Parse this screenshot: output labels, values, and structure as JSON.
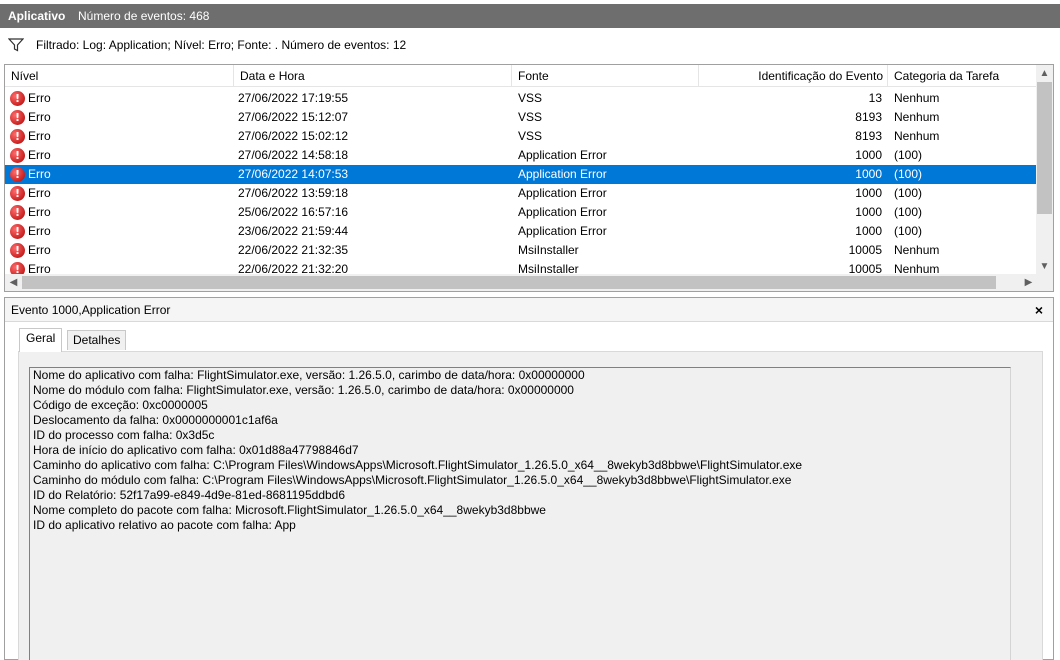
{
  "title": {
    "app": "Aplicativo",
    "count": "Número de eventos: 468"
  },
  "filter": {
    "text": "Filtrado: Log: Application; Nível: Erro; Fonte: . Número de eventos: 12"
  },
  "columns": {
    "level": "Nível",
    "date": "Data e Hora",
    "source": "Fonte",
    "event_id": "Identificação do Evento",
    "category": "Categoria da Tarefa"
  },
  "rows": [
    {
      "level": "Erro",
      "date": "27/06/2022 17:19:55",
      "source": "VSS",
      "event_id": "13",
      "category": "Nenhum",
      "selected": false
    },
    {
      "level": "Erro",
      "date": "27/06/2022 15:12:07",
      "source": "VSS",
      "event_id": "8193",
      "category": "Nenhum",
      "selected": false
    },
    {
      "level": "Erro",
      "date": "27/06/2022 15:02:12",
      "source": "VSS",
      "event_id": "8193",
      "category": "Nenhum",
      "selected": false
    },
    {
      "level": "Erro",
      "date": "27/06/2022 14:58:18",
      "source": "Application Error",
      "event_id": "1000",
      "category": "(100)",
      "selected": false
    },
    {
      "level": "Erro",
      "date": "27/06/2022 14:07:53",
      "source": "Application Error",
      "event_id": "1000",
      "category": "(100)",
      "selected": true
    },
    {
      "level": "Erro",
      "date": "27/06/2022 13:59:18",
      "source": "Application Error",
      "event_id": "1000",
      "category": "(100)",
      "selected": false
    },
    {
      "level": "Erro",
      "date": "25/06/2022 16:57:16",
      "source": "Application Error",
      "event_id": "1000",
      "category": "(100)",
      "selected": false
    },
    {
      "level": "Erro",
      "date": "23/06/2022 21:59:44",
      "source": "Application Error",
      "event_id": "1000",
      "category": "(100)",
      "selected": false
    },
    {
      "level": "Erro",
      "date": "22/06/2022 21:32:35",
      "source": "MsiInstaller",
      "event_id": "10005",
      "category": "Nenhum",
      "selected": false
    },
    {
      "level": "Erro",
      "date": "22/06/2022 21:32:20",
      "source": "MsiInstaller",
      "event_id": "10005",
      "category": "Nenhum",
      "selected": false
    }
  ],
  "detail": {
    "header": "Evento 1000,Application Error",
    "close": "×",
    "tabs": [
      "Geral",
      "Detalhes"
    ],
    "lines": [
      "Nome do aplicativo com falha: FlightSimulator.exe, versão: 1.26.5.0, carimbo de data/hora: 0x00000000",
      "Nome do módulo com falha: FlightSimulator.exe, versão: 1.26.5.0, carimbo de data/hora: 0x00000000",
      "Código de exceção: 0xc0000005",
      "Deslocamento da falha: 0x0000000001c1af6a",
      "ID do processo com falha: 0x3d5c",
      "Hora de início do aplicativo com falha: 0x01d88a47798846d7",
      "Caminho do aplicativo com falha: C:\\Program Files\\WindowsApps\\Microsoft.FlightSimulator_1.26.5.0_x64__8wekyb3d8bbwe\\FlightSimulator.exe",
      "Caminho do módulo com falha: C:\\Program Files\\WindowsApps\\Microsoft.FlightSimulator_1.26.5.0_x64__8wekyb3d8bbwe\\FlightSimulator.exe",
      "ID do Relatório: 52f17a99-e849-4d9e-81ed-8681195ddbd6",
      "Nome completo do pacote com falha: Microsoft.FlightSimulator_1.26.5.0_x64__8wekyb3d8bbwe",
      "ID do aplicativo relativo ao pacote com falha: App"
    ]
  },
  "icons": {
    "filter": "filter-funnel-icon",
    "error": "error-icon",
    "close": "close-icon"
  },
  "colors": {
    "titlebar": "#6e6e6e",
    "selection": "#0078d7",
    "error": "#c00000"
  }
}
